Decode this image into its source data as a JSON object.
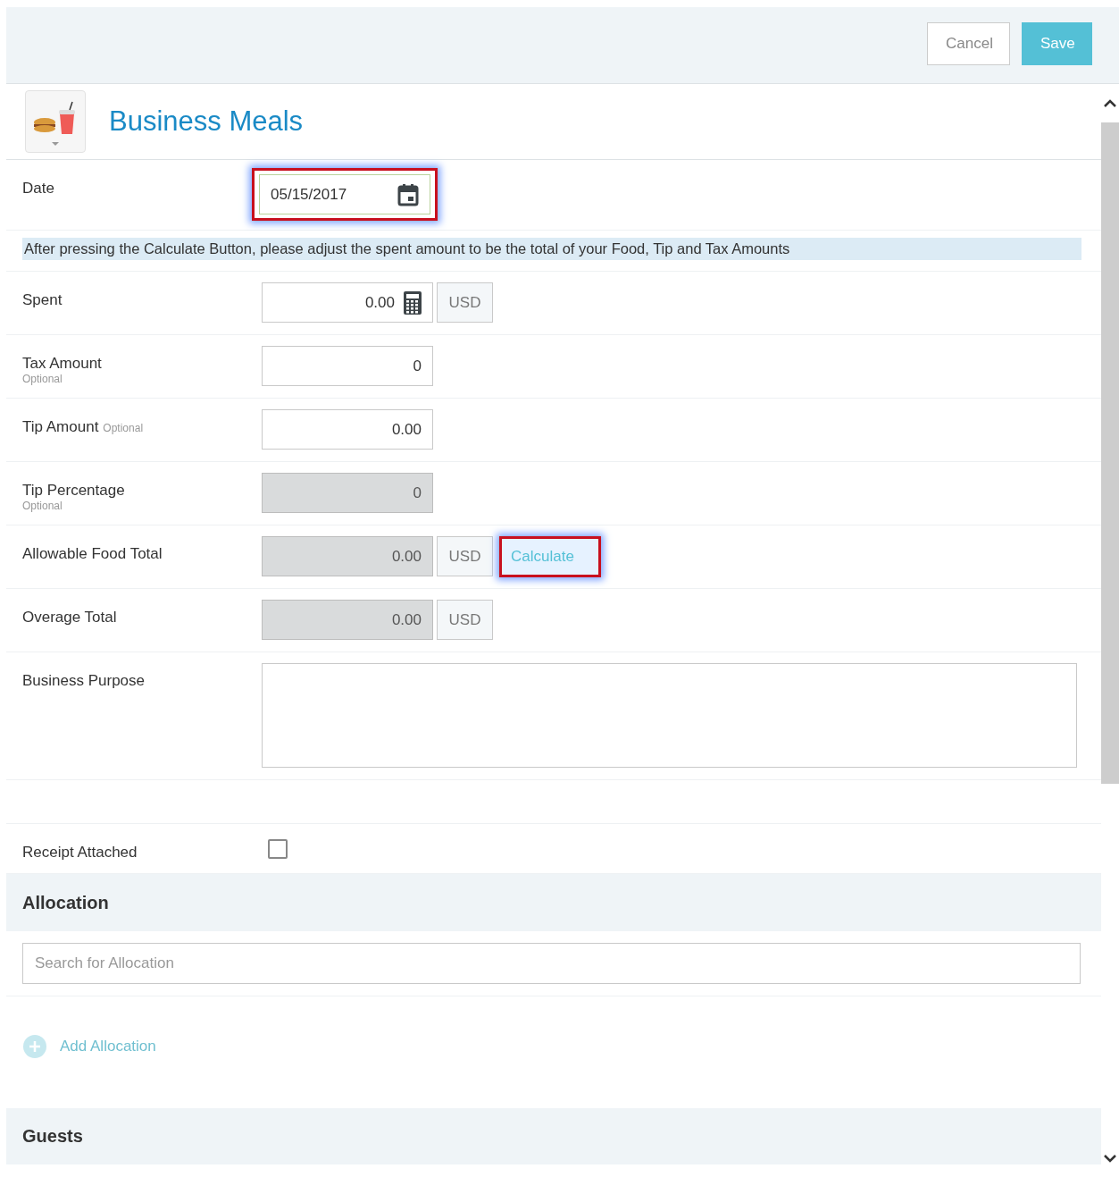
{
  "toolbar": {
    "buttons": [
      {
        "label": "Cancel",
        "kind": "secondary"
      },
      {
        "label": "Save",
        "kind": "primary"
      }
    ]
  },
  "header": {
    "title": "Business Meals"
  },
  "fields": [
    {
      "label": "Date",
      "kind": "date",
      "value": "05/15/2017",
      "highlighted": true
    },
    {
      "kind": "note",
      "text": "After pressing the Calculate Button, please adjust the spent amount to be the total of your Food, Tip and Tax Amounts"
    },
    {
      "label": "Spent",
      "kind": "amount",
      "value": "0.00",
      "disabled": false,
      "calculator": true,
      "currency": "USD"
    },
    {
      "label": "Tax Amount",
      "hint": "Optional",
      "kind": "amount",
      "value": "0",
      "disabled": false,
      "calculator": false
    },
    {
      "label": "Tip Amount",
      "note": "Optional",
      "kind": "amount",
      "value": "0.00",
      "disabled": false,
      "calculator": false
    },
    {
      "label": "Tip Percentage",
      "hint": "Optional",
      "kind": "amount",
      "value": "0",
      "disabled": true,
      "calculator": false
    },
    {
      "label": "Allowable Food Total",
      "kind": "amount",
      "value": "0.00",
      "disabled": true,
      "calculator": false,
      "currency": "USD",
      "action": {
        "label": "Calculate",
        "highlighted": true
      }
    },
    {
      "label": "Overage Total",
      "kind": "amount",
      "value": "0.00",
      "disabled": true,
      "calculator": false,
      "currency": "USD"
    },
    {
      "label": "Business Purpose",
      "kind": "textarea"
    },
    {
      "kind": "spacer"
    },
    {
      "label": "Receipt Attached",
      "kind": "checkbox",
      "checked": false
    }
  ],
  "allocation": {
    "title": "Allocation",
    "search": {
      "placeholder": "Search for Allocation"
    },
    "add_link": "Add Allocation"
  },
  "guests": {
    "title": "Guests"
  }
}
